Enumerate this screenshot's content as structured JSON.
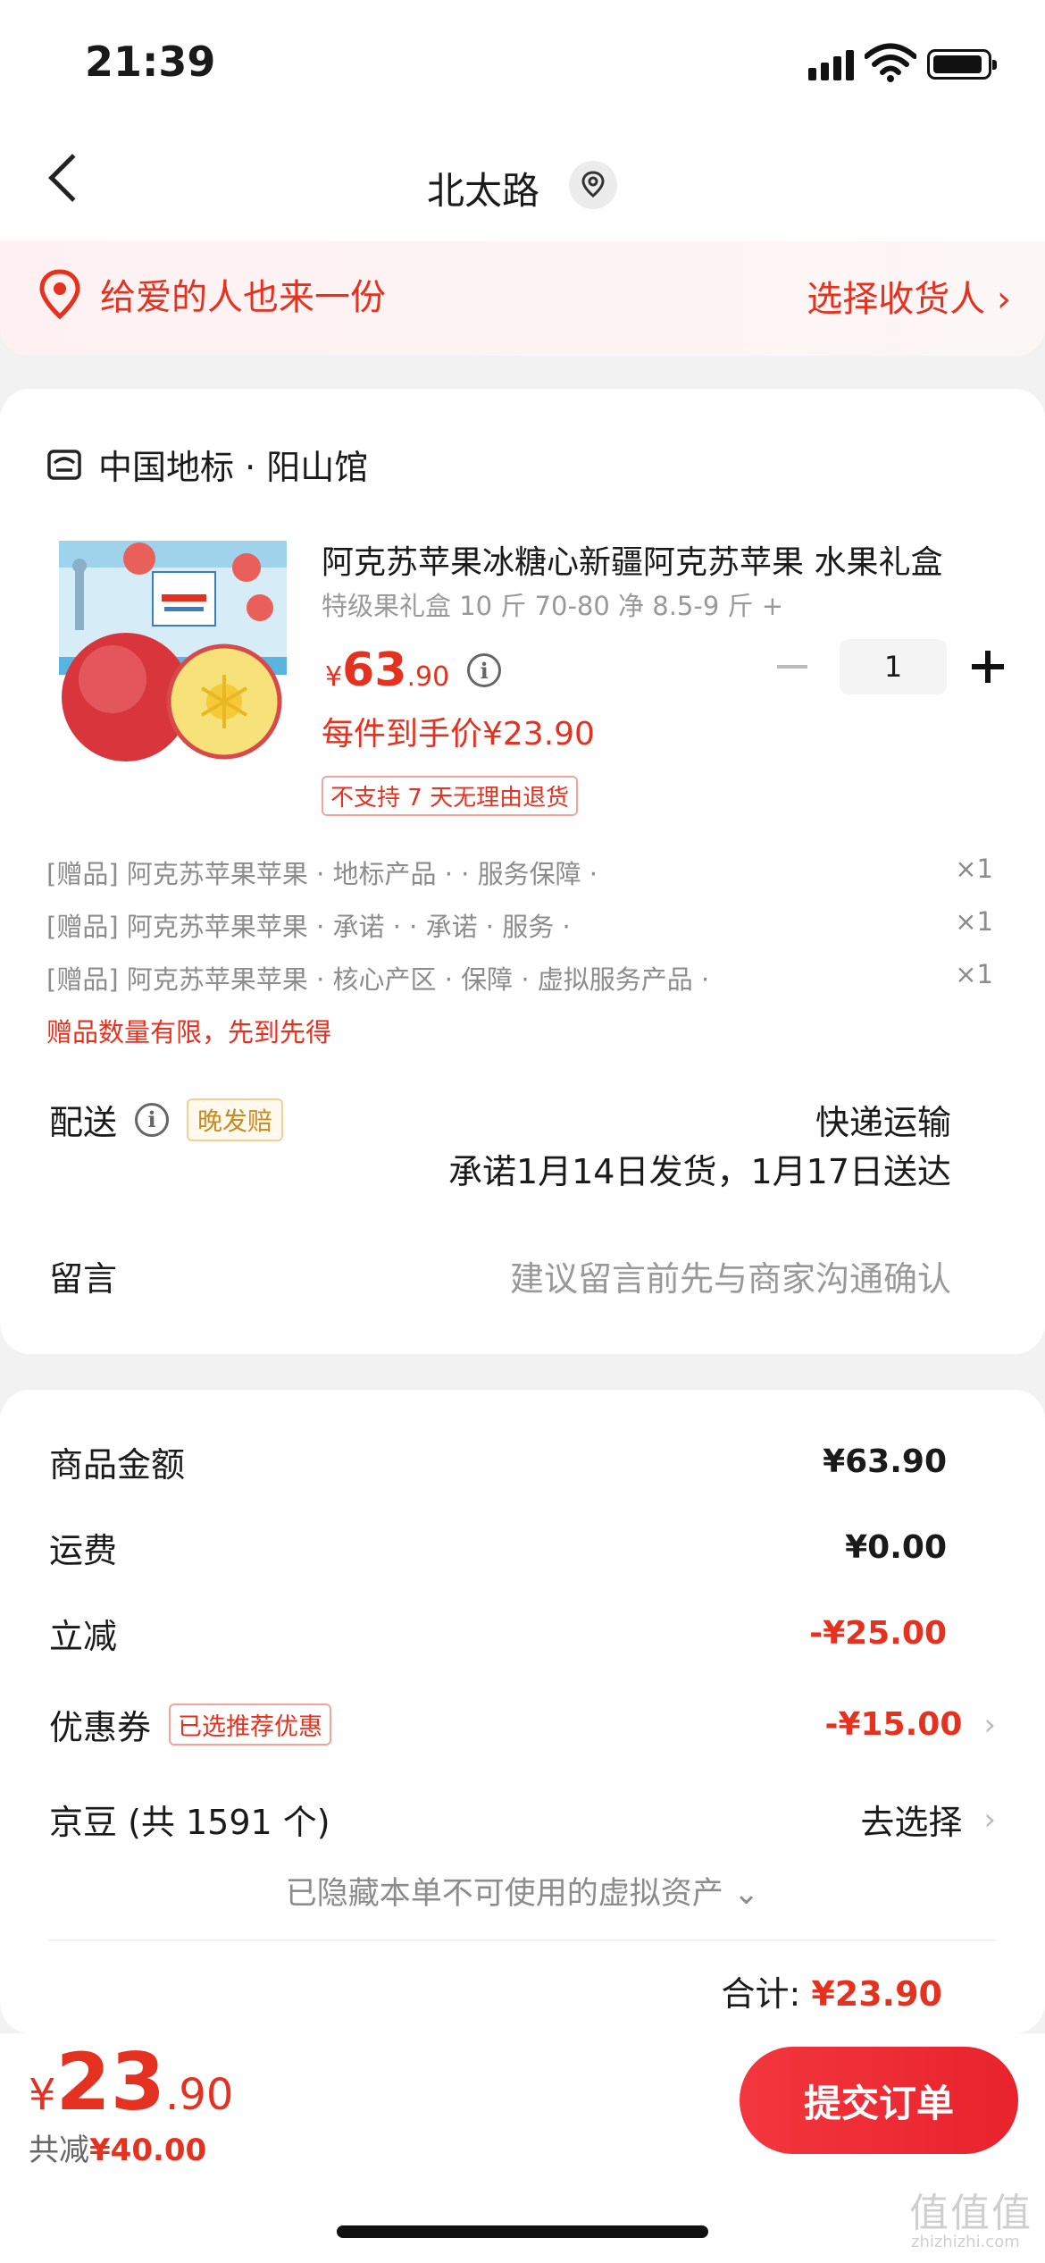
{
  "status": {
    "time": "21:39"
  },
  "nav": {
    "title": "北太路"
  },
  "banner": {
    "left": "给爱的人也来一份",
    "right": "选择收货人 ›"
  },
  "shop": {
    "name": "中国地标 · 阳山馆"
  },
  "product": {
    "title": "阿克苏苹果冰糖心新疆阿克苏苹果 水果礼盒",
    "spec": "特级果礼盒 10 斤 70-80 净 8.5-9 斤 +",
    "price_currency": "¥",
    "price_int": "63",
    "price_dec": ".90",
    "unit_price": "每件到手价¥23.90",
    "no_return": "不支持 7 天无理由退货",
    "quantity": "1"
  },
  "gifts": [
    {
      "text": "[赠品] 阿克苏苹果苹果 · 地标产品 · · 服务保障 ·",
      "qty": "×1"
    },
    {
      "text": "[赠品] 阿克苏苹果苹果 · 承诺 · · 承诺 · 服务 ·",
      "qty": "×1"
    },
    {
      "text": "[赠品] 阿克苏苹果苹果 · 核心产区 · 保障 · 虚拟服务产品 ·",
      "qty": "×1"
    }
  ],
  "gift_note": "赠品数量有限，先到先得",
  "delivery": {
    "label": "配送",
    "tag": "晚发赔",
    "method": "快递运输",
    "promise": "承诺1月14日发货，1月17日送达"
  },
  "message": {
    "label": "留言",
    "placeholder": "建议留言前先与商家沟通确认"
  },
  "summary": {
    "goods_label": "商品金额",
    "goods_value": "¥63.90",
    "freight_label": "运费",
    "freight_value": "¥0.00",
    "discount_label": "立减",
    "discount_value": "-¥25.00",
    "coupon_label": "优惠券",
    "coupon_tag": "已选推荐优惠",
    "coupon_value": "-¥15.00",
    "jingdou_label": "京豆 (共 1591 个)",
    "jingdou_value": "去选择",
    "hidden_assets": "已隐藏本单不可使用的虚拟资产 ⌄",
    "total_label": "合计:",
    "total_value": "¥23.90"
  },
  "bottom": {
    "currency": "¥",
    "int": "23",
    "dec": ".90",
    "saved_label": "共减",
    "saved_value": "¥40.00",
    "submit": "提交订单"
  },
  "watermark": {
    "logo": "值值值",
    "domain": "zhizhizhi.com"
  },
  "colors": {
    "accent": "#e5311f",
    "button": "#ec2a33"
  }
}
